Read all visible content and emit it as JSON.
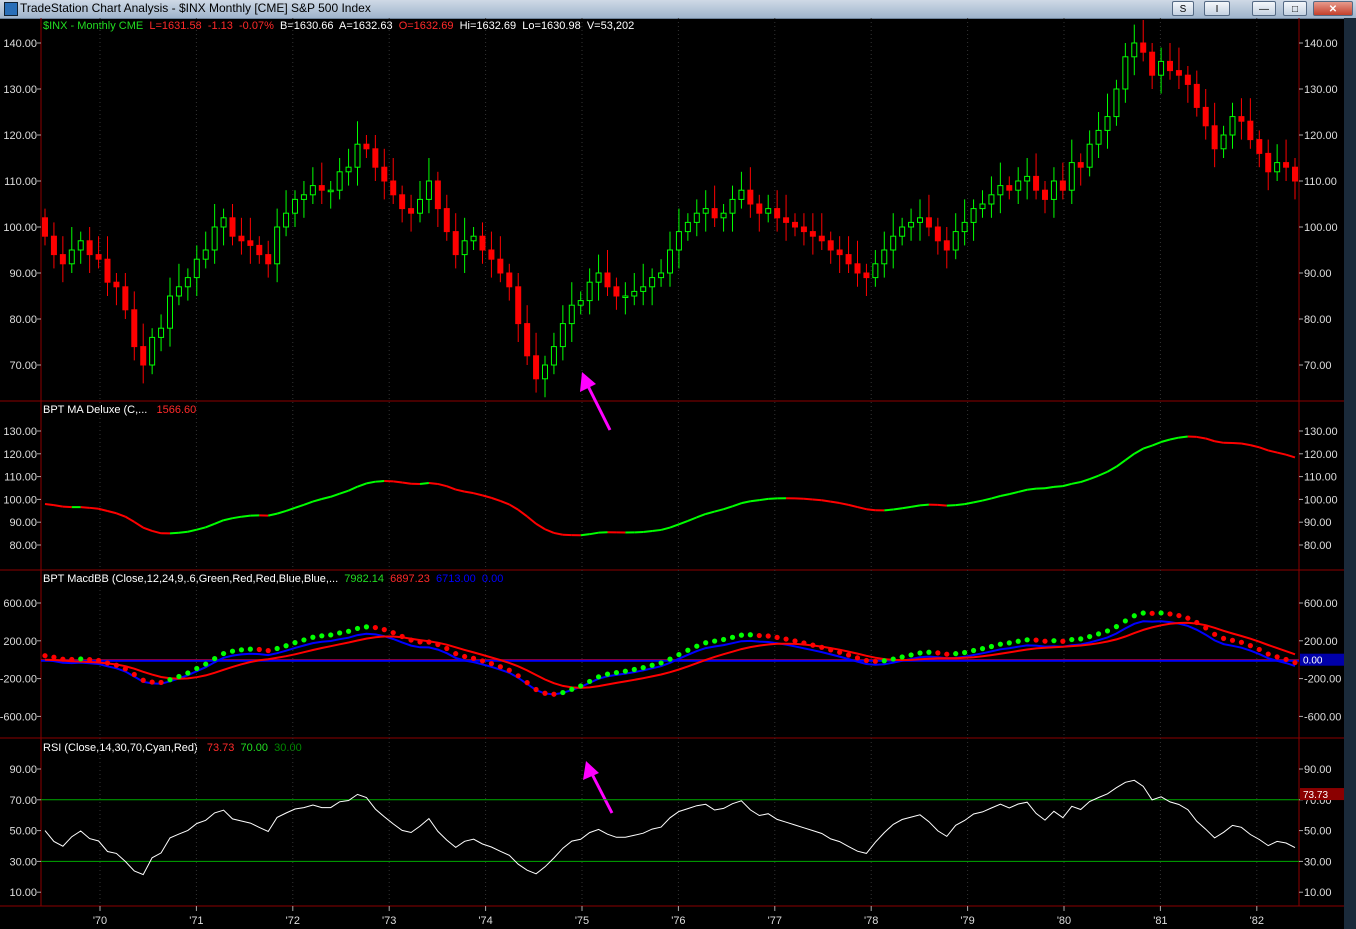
{
  "window": {
    "title": "TradeStation Chart Analysis - $INX Monthly [CME] S&P 500 Index",
    "buttons": [
      "S",
      "I",
      "—",
      "□",
      "✕"
    ]
  },
  "colors": {
    "up": "#00ff00",
    "down": "#ff0000",
    "macd_signal": "#0000ff",
    "rsi": "#ffffff",
    "arrow": "#ff00ff"
  },
  "symbol_bar": {
    "symbol": "$INX - Monthly  CME",
    "last": "L=1631.58",
    "change": "-1.13",
    "pct": "-0.07%",
    "bid": "B=1630.66",
    "ask": "A=1632.63",
    "open": "O=1632.69",
    "high": "Hi=1632.69",
    "low": "Lo=1630.98",
    "volume": "V=53,202"
  },
  "ma_panel": {
    "label": "BPT MA Deluxe (C,...",
    "value": "1566.60"
  },
  "macd_panel": {
    "label": "BPT MacdBB (Close,12,24,9,.6,Green,Red,Red,Blue,Blue,...",
    "v1": "7982.14",
    "v2": "6897.23",
    "v3": "6713.00",
    "v4": "0.00",
    "zero_tag": "0.00"
  },
  "rsi_panel": {
    "label": "RSI (Close,14,30,70,Cyan,Red)",
    "v1": "73.73",
    "v2": "70.00",
    "v3": "30.00",
    "tag": "73.73"
  },
  "chart_data": {
    "type": "candlestick",
    "x_axis_labels": [
      "'70",
      "'71",
      "'72",
      "'73",
      "'74",
      "'75",
      "'76",
      "'77",
      "'78",
      "'79",
      "'80",
      "'81",
      "'82"
    ],
    "price_axis": [
      "140.00",
      "130.00",
      "120.00",
      "110.00",
      "100.00",
      "90.00",
      "80.00",
      "70.00"
    ],
    "ma_axis": [
      "130.00",
      "120.00",
      "110.00",
      "100.00",
      "90.00",
      "80.00"
    ],
    "macd_axis": [
      "600.00",
      "200.00",
      "-200.00",
      "-600.00"
    ],
    "rsi_axis": [
      "90.00",
      "70.00",
      "50.00",
      "30.00",
      "10.00"
    ],
    "price_closes": [
      98,
      94,
      92,
      95,
      97,
      94,
      93,
      88,
      87,
      82,
      74,
      70,
      76,
      78,
      85,
      87,
      89,
      93,
      95,
      100,
      102,
      98,
      97,
      96,
      94,
      92,
      100,
      103,
      106,
      107,
      109,
      108,
      108,
      112,
      113,
      118,
      117,
      113,
      110,
      107,
      104,
      103,
      106,
      110,
      104,
      99,
      94,
      97,
      98,
      95,
      93,
      90,
      87,
      79,
      72,
      67,
      70,
      74,
      79,
      83,
      84,
      88,
      90,
      87,
      85,
      85,
      86,
      87,
      89,
      90,
      95,
      99,
      101,
      103,
      104,
      102,
      103,
      106,
      108,
      105,
      103,
      104,
      102,
      101,
      100,
      99,
      98,
      97,
      95,
      94,
      92,
      90,
      89,
      92,
      95,
      98,
      100,
      101,
      102,
      100,
      97,
      95,
      99,
      101,
      104,
      105,
      107,
      109,
      108,
      110,
      111,
      108,
      106,
      110,
      108,
      114,
      113,
      118,
      121,
      124,
      130,
      137,
      140,
      138,
      133,
      136,
      134,
      133,
      131,
      126,
      122,
      117,
      120,
      124,
      123,
      119,
      116,
      112,
      114,
      113,
      110
    ]
  }
}
